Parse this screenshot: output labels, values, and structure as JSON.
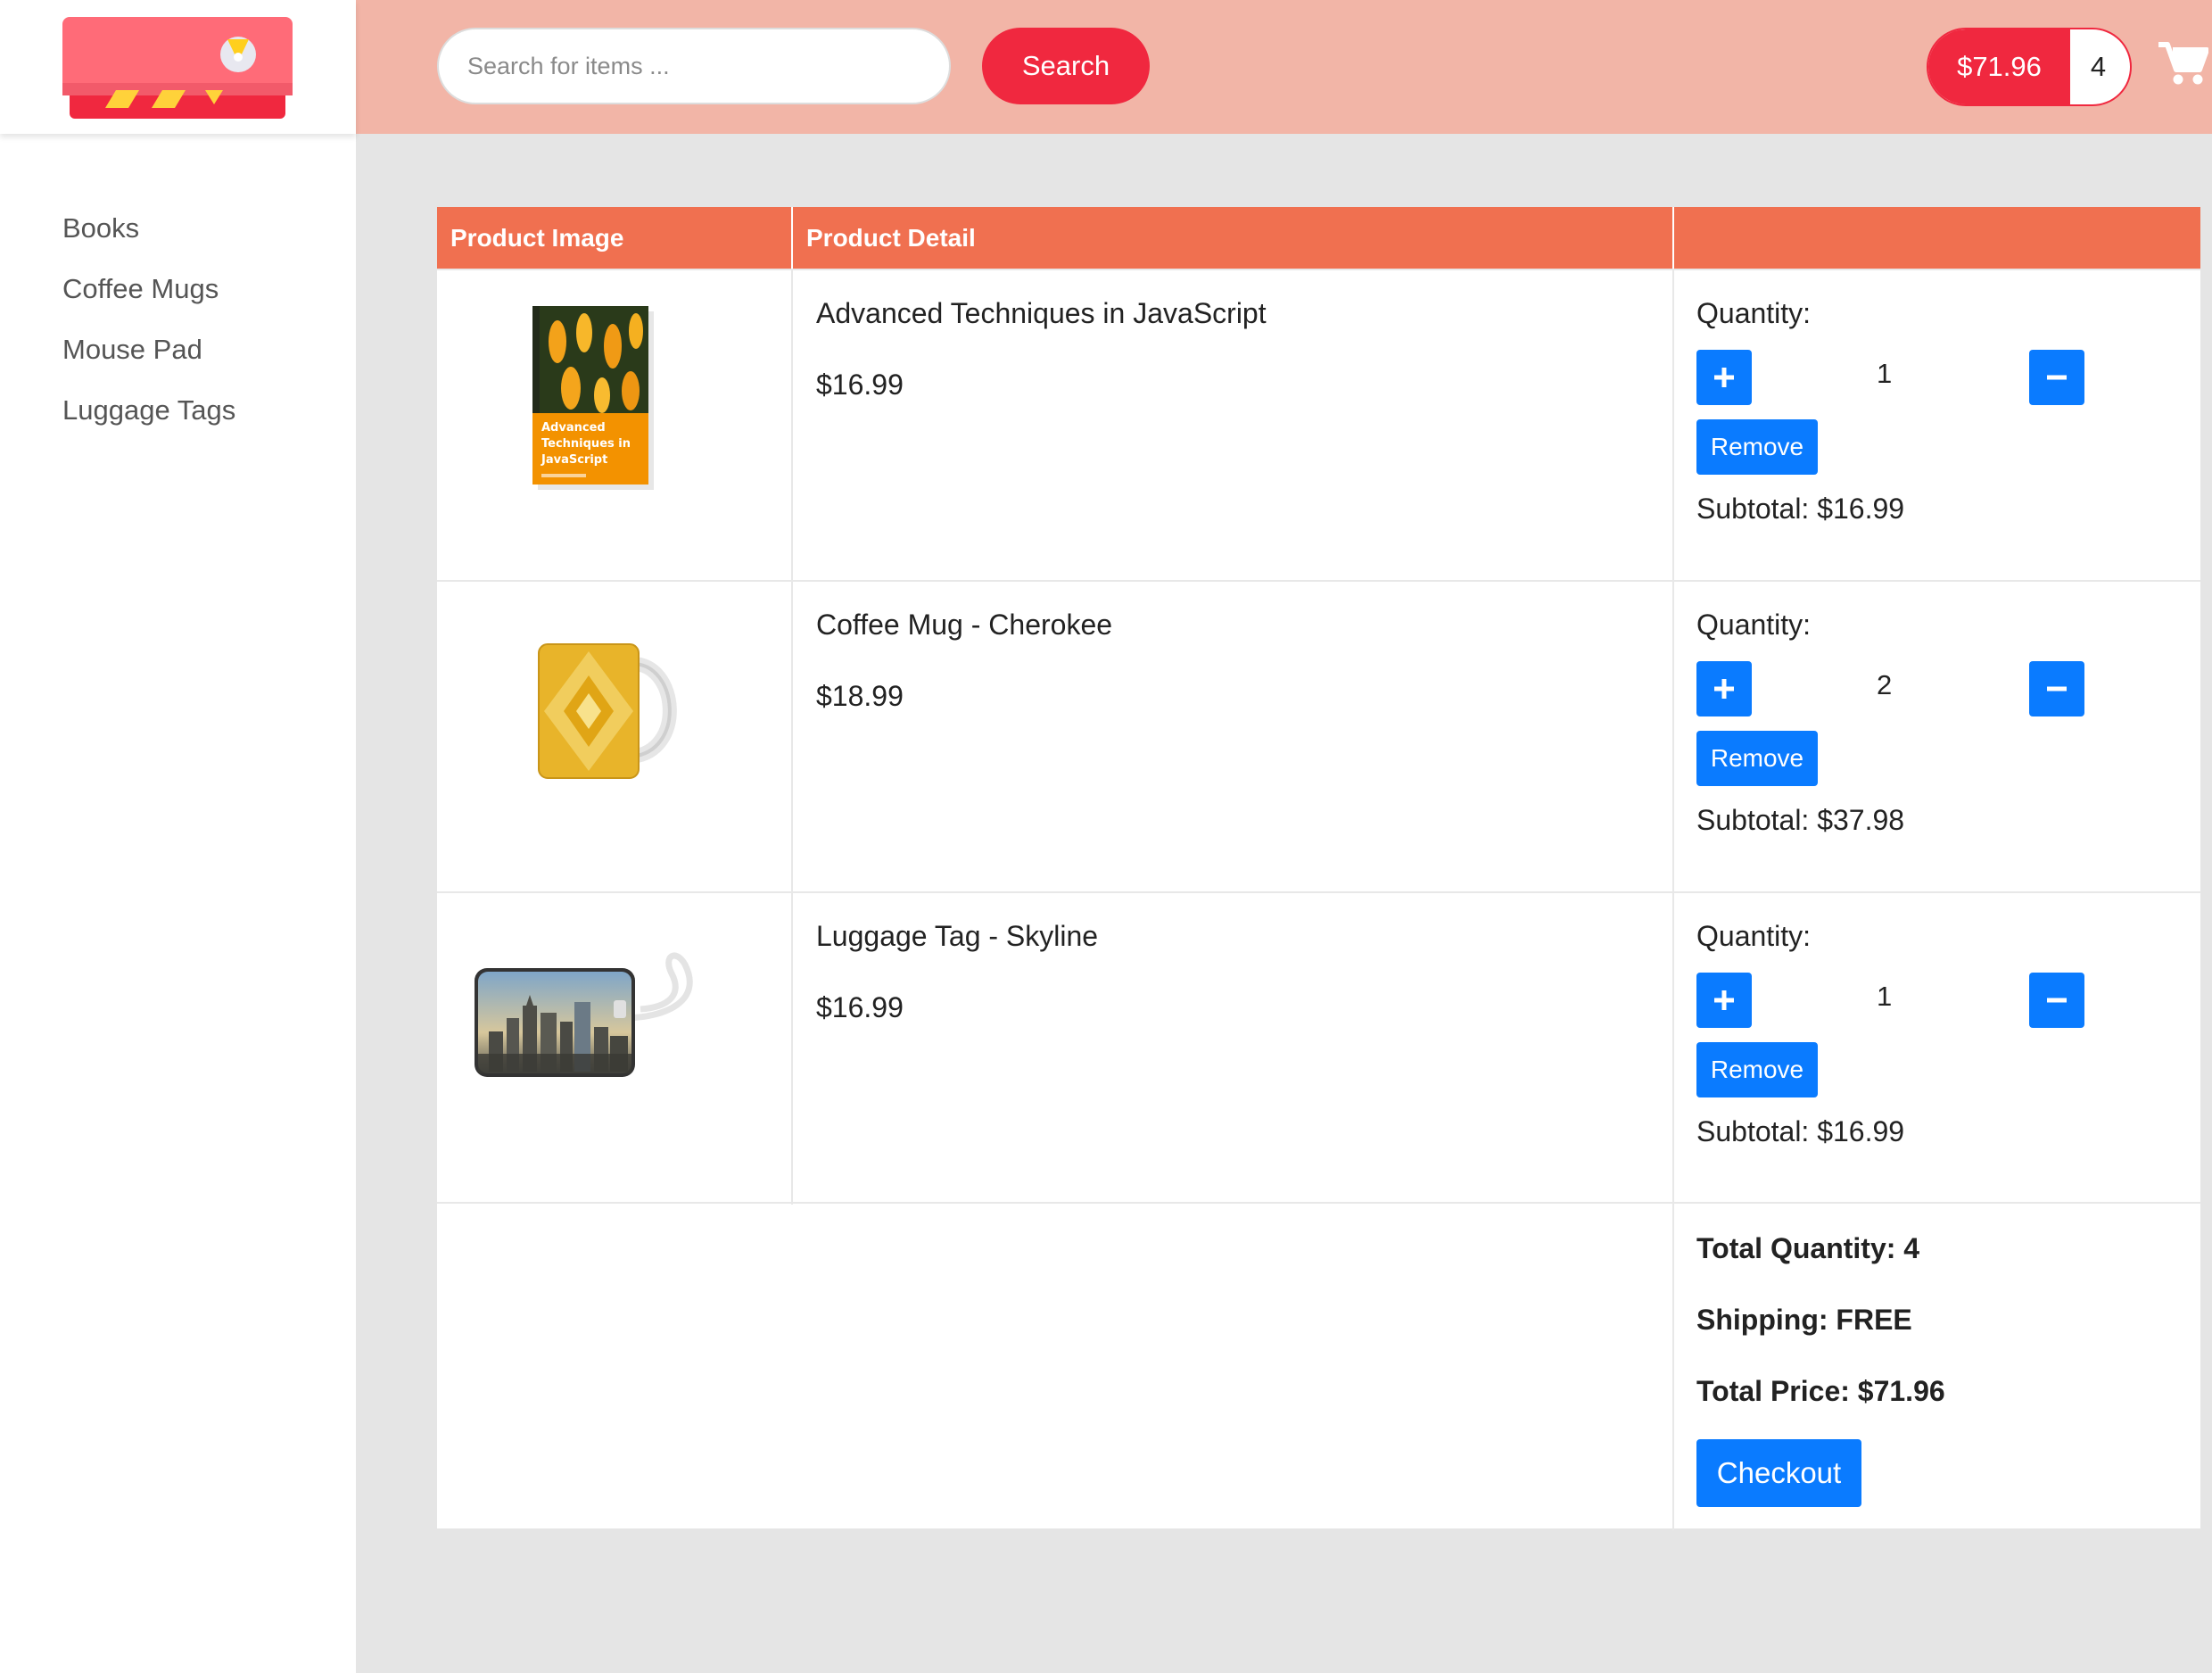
{
  "sidebar": {
    "logo": "logo",
    "items": [
      {
        "label": "Books"
      },
      {
        "label": "Coffee Mugs"
      },
      {
        "label": "Mouse Pad"
      },
      {
        "label": "Luggage Tags"
      }
    ]
  },
  "header": {
    "search_placeholder": "Search for items ...",
    "search_label": "Search",
    "cart_total": "$71.96",
    "cart_count": "4",
    "cart_icon": "shopping-cart-icon"
  },
  "table": {
    "headers": [
      "Product Image",
      "Product Detail",
      ""
    ],
    "rows": [
      {
        "name": "Advanced Techniques in JavaScript",
        "price": "$16.99",
        "quantity_label": "Quantity:",
        "quantity": "1",
        "remove_label": "Remove",
        "subtotal": "Subtotal: $16.99",
        "image": "book-cover"
      },
      {
        "name": "Coffee Mug - Cherokee",
        "price": "$18.99",
        "quantity_label": "Quantity:",
        "quantity": "2",
        "remove_label": "Remove",
        "subtotal": "Subtotal: $37.98",
        "image": "coffee-mug"
      },
      {
        "name": "Luggage Tag - Skyline",
        "price": "$16.99",
        "quantity_label": "Quantity:",
        "quantity": "1",
        "remove_label": "Remove",
        "subtotal": "Subtotal: $16.99",
        "image": "luggage-tag"
      }
    ],
    "book_cover_text": "Advanced Techniques in JavaScript"
  },
  "summary": {
    "total_quantity": "Total Quantity: 4",
    "shipping": "Shipping: FREE",
    "total_price": "Total Price: $71.96",
    "checkout_label": "Checkout"
  },
  "colors": {
    "header_bg": "#f2b5a7",
    "accent_red": "#f0283f",
    "table_header": "#f07050",
    "button_blue": "#0a7bff"
  }
}
